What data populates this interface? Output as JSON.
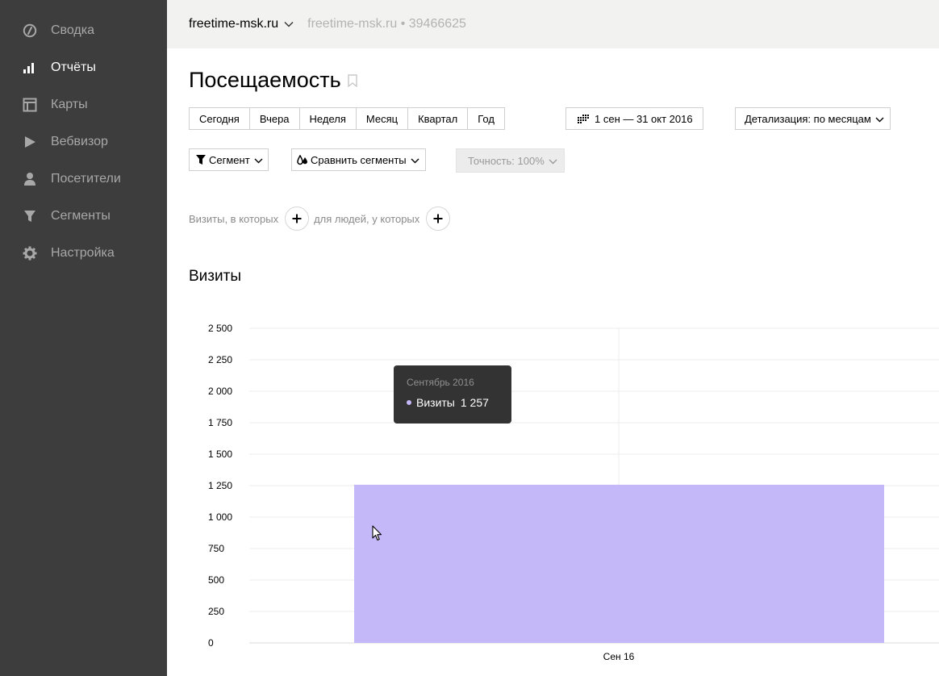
{
  "sidebar": {
    "items": [
      {
        "label": "Сводка",
        "icon": "dashboard-icon",
        "active": false
      },
      {
        "label": "Отчёты",
        "icon": "bar-chart-icon",
        "active": true
      },
      {
        "label": "Карты",
        "icon": "map-grid-icon",
        "active": false
      },
      {
        "label": "Вебвизор",
        "icon": "play-icon",
        "active": false
      },
      {
        "label": "Посетители",
        "icon": "person-icon",
        "active": false
      },
      {
        "label": "Сегменты",
        "icon": "funnel-icon",
        "active": false
      },
      {
        "label": "Настройка",
        "icon": "gear-icon",
        "active": false
      }
    ]
  },
  "topbar": {
    "counter": "freetime-msk.ru",
    "counter_info": "freetime-msk.ru • 39466625"
  },
  "page": {
    "title": "Посещаемость"
  },
  "period": {
    "buttons": [
      "Сегодня",
      "Вчера",
      "Неделя",
      "Месяц",
      "Квартал",
      "Год"
    ],
    "date_range": "1 сен — 31 окт 2016",
    "detail": "Детализация: по месяцам"
  },
  "toolbar": {
    "segment": "Сегмент",
    "compare": "Сравнить сегменты",
    "accuracy": "Точность: 100%"
  },
  "filters": {
    "visits_label": "Визиты, в которых",
    "people_label": "для людей, у которых"
  },
  "section": {
    "title": "Визиты"
  },
  "tooltip": {
    "title": "Сентябрь 2016",
    "series": "Визиты",
    "value": "1 257"
  },
  "colors": {
    "sidebar_bg": "#3d3d3d",
    "bar": "#c5b8f8",
    "tooltip_bg": "#333333"
  },
  "chart_data": {
    "type": "bar",
    "categories": [
      "Сен 16"
    ],
    "series": [
      {
        "name": "Визиты",
        "values": [
          1257
        ]
      }
    ],
    "ylim": [
      0,
      2500
    ],
    "yticks": [
      0,
      250,
      500,
      750,
      1000,
      1250,
      1500,
      1750,
      2000,
      2250,
      2500
    ],
    "ytick_labels": [
      "0",
      "250",
      "500",
      "750",
      "1 000",
      "1 250",
      "1 500",
      "1 750",
      "2 000",
      "2 250",
      "2 500"
    ],
    "grid": true
  }
}
